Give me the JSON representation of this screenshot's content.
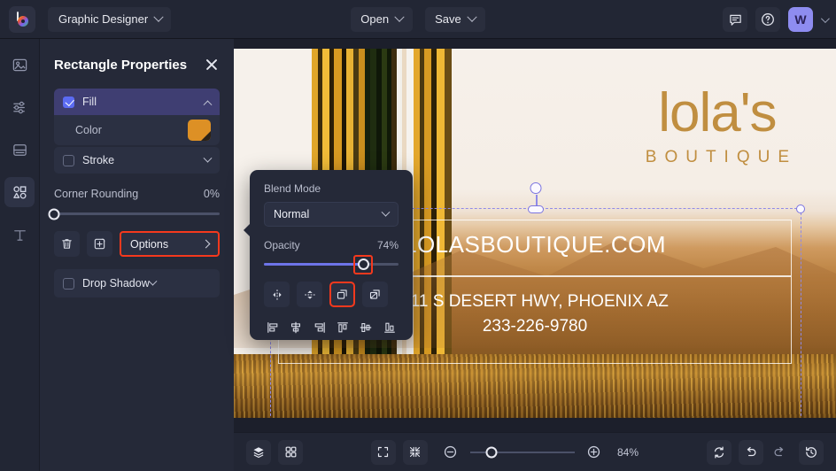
{
  "app": {
    "logo_icon": "colorwheel-logo-icon",
    "document_name": "Graphic Designer"
  },
  "topbar": {
    "open_label": "Open",
    "save_label": "Save",
    "comment_icon": "comment-icon",
    "help_icon": "help-circle-icon",
    "avatar_initial": "W"
  },
  "rail": {
    "items": [
      {
        "icon": "image-icon",
        "name": "images"
      },
      {
        "icon": "sliders-icon",
        "name": "adjustments"
      },
      {
        "icon": "layout-icon",
        "name": "layouts"
      },
      {
        "icon": "shapes-icon",
        "name": "shapes"
      },
      {
        "icon": "text-icon",
        "name": "text"
      }
    ]
  },
  "properties": {
    "title": "Rectangle Properties",
    "close_icon": "close-icon",
    "fill": {
      "label": "Fill",
      "checked": true,
      "caret": "chevron-up-icon"
    },
    "color": {
      "label": "Color",
      "value": "#dd9025"
    },
    "stroke": {
      "label": "Stroke",
      "checked": false,
      "caret": "chevron-down-icon"
    },
    "corner_rounding": {
      "label": "Corner Rounding",
      "value": "0%",
      "percent": 0
    },
    "delete_icon": "trash-icon",
    "duplicate_icon": "duplicate-icon",
    "options_label": "Options",
    "options_caret": "chevron-right-icon",
    "drop_shadow": {
      "label": "Drop Shadow",
      "checked": false,
      "caret": "chevron-down-icon"
    }
  },
  "popover": {
    "blend_mode_label": "Blend Mode",
    "blend_mode_value": "Normal",
    "opacity_label": "Opacity",
    "opacity_value": "74%",
    "opacity_percent": 74,
    "tools": [
      {
        "icon": "flip-horizontal-icon",
        "highlighted": false
      },
      {
        "icon": "flip-vertical-icon",
        "highlighted": false
      },
      {
        "icon": "duplicate-layer-icon",
        "highlighted": true
      },
      {
        "icon": "mask-layers-icon",
        "highlighted": false
      }
    ],
    "align_tools": [
      {
        "icon": "align-left-icon"
      },
      {
        "icon": "align-center-horizontal-icon"
      },
      {
        "icon": "align-right-icon"
      },
      {
        "icon": "align-top-icon"
      },
      {
        "icon": "align-middle-vertical-icon"
      },
      {
        "icon": "align-bottom-icon"
      }
    ]
  },
  "canvas": {
    "brand_name": "lola's",
    "brand_sub": "BOUTIQUE",
    "website": "LOLASBOUTIQUE.COM",
    "address_line1": "211 S DESERT HWY, PHOENIX AZ",
    "address_line2": "233-226-9780"
  },
  "bottombar": {
    "layers_icon": "layers-icon",
    "grid_icon": "grid-icon",
    "fit_icon": "fit-screen-icon",
    "shrink_icon": "shrink-icon",
    "zoom_out_icon": "zoom-out-icon",
    "zoom_in_icon": "zoom-in-icon",
    "zoom_level": "84%",
    "zoom_percent": 84,
    "sync_icon": "sync-icon",
    "undo_icon": "undo-icon",
    "redo_icon": "redo-icon",
    "history_icon": "history-icon"
  },
  "colors": {
    "accent": "#5b6bf2",
    "highlight_red": "#f5391d",
    "fill_color": "#dd9025",
    "panel_bg": "#252938"
  }
}
